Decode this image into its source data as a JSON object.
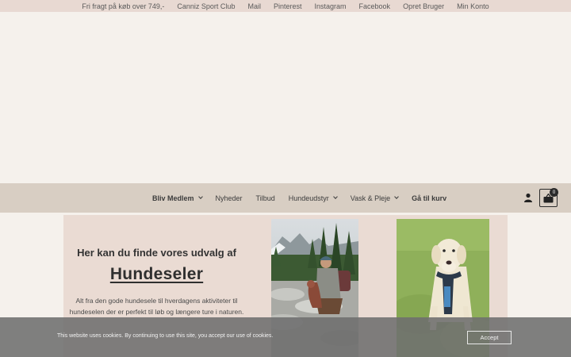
{
  "topbar": {
    "links": [
      "Fri fragt på køb over 749,-",
      "Canniz Sport Club",
      "Mail",
      "Pinterest",
      "Instagram",
      "Facebook",
      "Opret Bruger",
      "Min Konto"
    ]
  },
  "nav": {
    "items": [
      {
        "label": "Bliv Medlem"
      },
      {
        "label": "Nyheder"
      },
      {
        "label": "Tilbud"
      },
      {
        "label": "Hundeudstyr"
      },
      {
        "label": "Vask & Pleje"
      },
      {
        "label": "Gå til kurv"
      }
    ],
    "cart_count": "0"
  },
  "hero": {
    "subtitle": "Her kan du finde vores udvalg af",
    "title": "Hundeseler",
    "description_line1": "Alt fra den gode hundesele til hverdagens aktiviteter til",
    "description_line2": "hundeselen der er perfekt til løb og længere ture i naturen."
  },
  "cookie": {
    "text": "This website uses cookies. By continuing to use this site, you accept our use of cookies.",
    "accept_label": "Accept"
  },
  "colors": {
    "topbar_bg": "#e8d9d2",
    "nav_bg": "#d8cec3",
    "hero_bg": "#eadbd3",
    "page_bg": "#f5f1ec"
  }
}
